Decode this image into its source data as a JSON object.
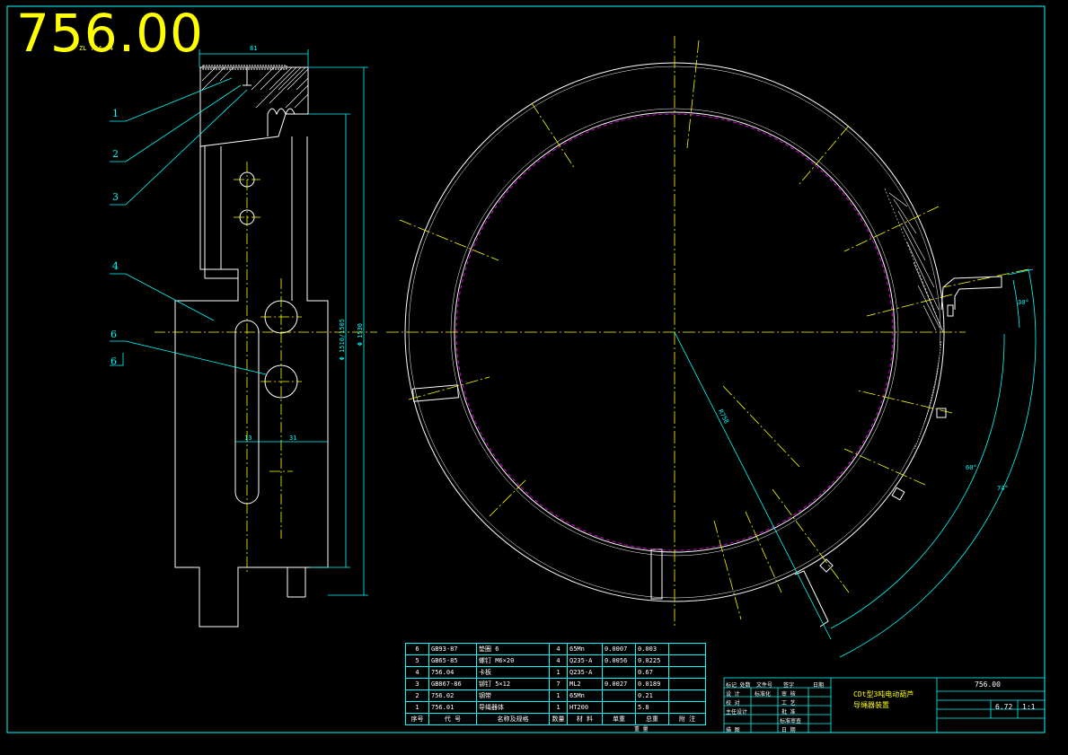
{
  "drawing_number": "756.00",
  "balloons": [
    "1",
    "2",
    "3",
    "4",
    "6",
    "6"
  ],
  "dimensions": {
    "top_width": "81",
    "top_tag": "ZL 754.54",
    "inner_diameter": "Φ 1510/1505",
    "outer_diameter": "Φ 1530",
    "left_width": "13",
    "right_width": "31",
    "radius": "R758",
    "angle_30": "30°",
    "angle_60": "60°",
    "angle_74": "74°"
  },
  "bom": {
    "rows": [
      {
        "no": "6",
        "code": "GB93-87",
        "name": "垫圈 6",
        "qty": "4",
        "material": "65Mn",
        "unit": "0.0007",
        "total": "0.003",
        "note": ""
      },
      {
        "no": "5",
        "code": "GB65-85",
        "name": "螺钉 M6×20",
        "qty": "4",
        "material": "Q235-A",
        "unit": "0.0056",
        "total": "0.0225",
        "note": ""
      },
      {
        "no": "4",
        "code": "756.04",
        "name": "卡板",
        "qty": "1",
        "material": "Q235-A",
        "unit": "",
        "total": "0.67",
        "note": ""
      },
      {
        "no": "3",
        "code": "GB867-86",
        "name": "铆钉 5×12",
        "qty": "7",
        "material": "ML2",
        "unit": "0.0027",
        "total": "0.0189",
        "note": ""
      },
      {
        "no": "2",
        "code": "756.02",
        "name": "钢带",
        "qty": "1",
        "material": "65Mn",
        "unit": "",
        "total": "0.21",
        "note": ""
      },
      {
        "no": "1",
        "code": "756.01",
        "name": "导绳器体",
        "qty": "1",
        "material": "HT200",
        "unit": "",
        "total": "5.8",
        "note": ""
      }
    ],
    "header": {
      "no": "序号",
      "code": "代 号",
      "name": "名称及规格",
      "qty": "数量",
      "material": "材 料",
      "unit": "单重",
      "total": "总重",
      "weight": "重 量",
      "note": "附 注"
    }
  },
  "title_block": {
    "title_line1": "CDt型3吨电动葫芦",
    "title_line2": "导绳器装置",
    "drawing_no": "756.00",
    "weight": "6.72",
    "scale": "1:1",
    "labels": [
      "标记 处数",
      "文件号",
      "签字",
      "日期",
      "设 计",
      "标准化",
      "审 核",
      "工 艺",
      "批 准",
      "日 期",
      "主任设计",
      "校 对",
      "描 图",
      "标准审查"
    ]
  },
  "colors": {
    "frame": "#00ffff",
    "geometry": "#ffffff",
    "centerline": "#ffff00",
    "hidden": "#ff00ff",
    "title": "#ffff00"
  }
}
